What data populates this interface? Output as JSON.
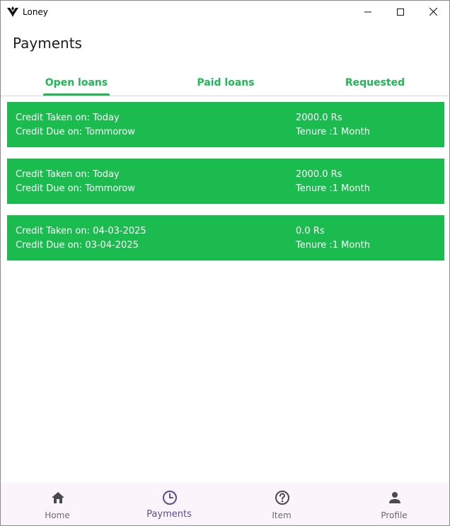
{
  "window": {
    "title": "Loney",
    "controls": [
      "minimize-icon",
      "maximize-icon",
      "close-icon"
    ]
  },
  "header": {
    "title": "Payments"
  },
  "tabs": [
    {
      "label": "Open loans",
      "active": true
    },
    {
      "label": "Paid loans",
      "active": false
    },
    {
      "label": "Requested",
      "active": false
    }
  ],
  "loans": [
    {
      "taken": "Credit Taken on: Today",
      "due": "Credit Due on: Tommorow",
      "amount": "2000.0 Rs",
      "tenure": "Tenure :1 Month"
    },
    {
      "taken": "Credit Taken on: Today",
      "due": "Credit Due on: Tommorow",
      "amount": "2000.0 Rs",
      "tenure": "Tenure :1 Month"
    },
    {
      "taken": "Credit Taken on: 04-03-2025",
      "due": "Credit Due on: 03-04-2025",
      "amount": "0.0 Rs",
      "tenure": "Tenure :1 Month"
    }
  ],
  "bottom_nav": [
    {
      "label": "Home",
      "icon": "home-icon",
      "active": false
    },
    {
      "label": "Payments",
      "icon": "clock-icon",
      "active": true
    },
    {
      "label": "Item",
      "icon": "help-circle-icon",
      "active": false
    },
    {
      "label": "Profile",
      "icon": "person-icon",
      "active": false
    }
  ],
  "colors": {
    "accent_green": "#1db954",
    "card_green": "#1bbb4f",
    "nav_background": "#fbf4fb",
    "nav_active": "#5b4d8f",
    "nav_inactive": "#6b6b6b"
  }
}
